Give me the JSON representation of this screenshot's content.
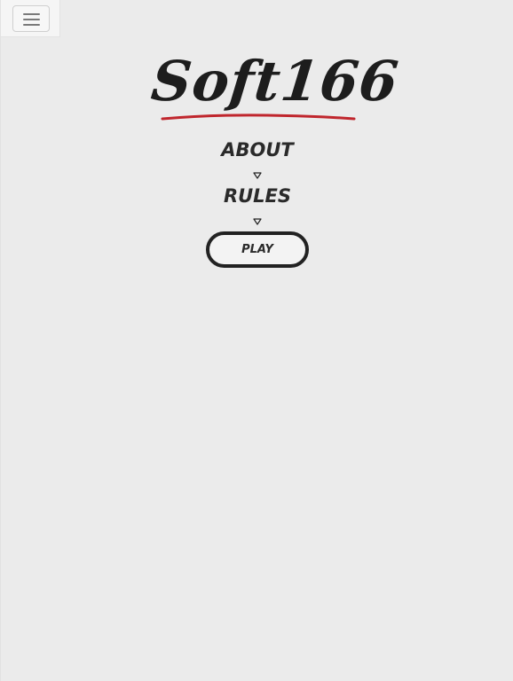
{
  "nav": {
    "menu_icon": "hamburger-menu-icon"
  },
  "brand": {
    "logo_text": "Soft166",
    "underline_color": "#c0262d"
  },
  "menu": {
    "about_label": "ABOUT",
    "about_caret_icon": "caret-down-icon",
    "rules_label": "RULES",
    "rules_caret_icon": "caret-down-icon",
    "play_label": "PLAY"
  },
  "colors": {
    "background": "#ebebeb",
    "text": "#2a2a2a",
    "accent": "#c0262d"
  }
}
